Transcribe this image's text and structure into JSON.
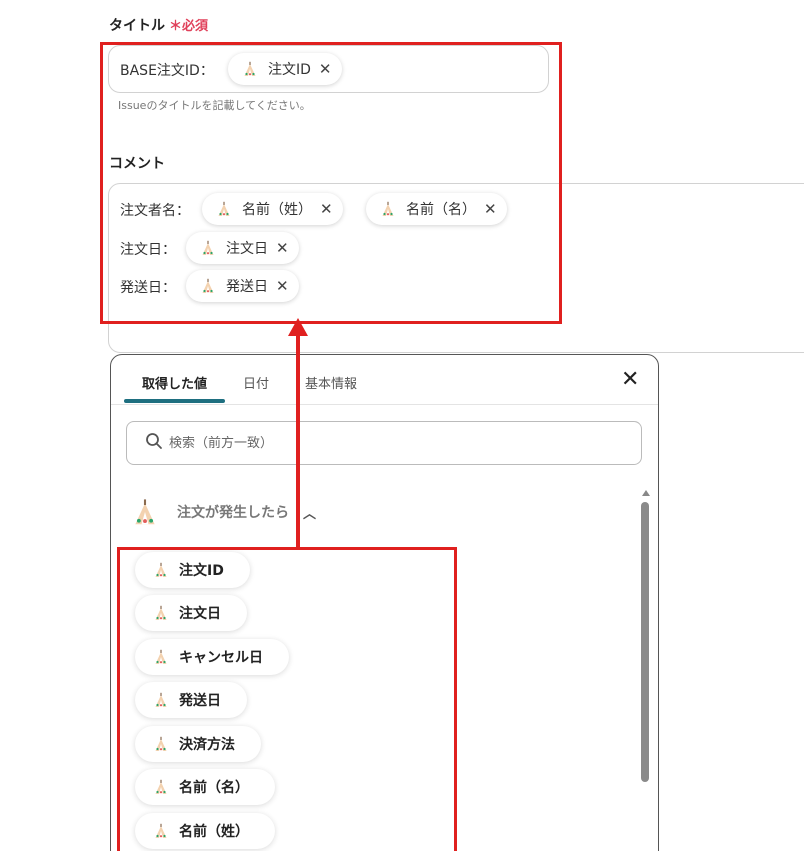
{
  "title_field": {
    "label": "タイトル",
    "required_mark": "＊",
    "required_text": "必須",
    "line_label": "BASE注文ID：",
    "chip": "注文ID",
    "hint": "Issueのタイトルを記載してください。"
  },
  "comment_field": {
    "label": "コメント",
    "lines": [
      {
        "label": "注文者名：",
        "chips": [
          "名前（姓）",
          "名前（名）"
        ]
      },
      {
        "label": "注文日：",
        "chips": [
          "注文日"
        ]
      },
      {
        "label": "発送日：",
        "chips": [
          "発送日"
        ]
      }
    ]
  },
  "chip_remove_glyph": "✕",
  "panel": {
    "tabs": [
      "取得した値",
      "日付",
      "基本情報"
    ],
    "active_tab": 0,
    "close_glyph": "✕",
    "search_placeholder": "検索（前方一致）",
    "group": {
      "title": "注文が発生したら",
      "chevron": "︿",
      "items": [
        "注文ID",
        "注文日",
        "キャンセル日",
        "発送日",
        "決済方法",
        "名前（名）",
        "名前（姓）"
      ]
    }
  },
  "icons": {
    "chip_icon": "teepee-icon",
    "search_icon": "search-icon",
    "close_icon": "close-icon",
    "chevron_icon": "chevron-up-icon"
  },
  "colors": {
    "required": "#e0405a",
    "tab_accent": "#1e6f80",
    "annotation_red": "#e0201f"
  }
}
